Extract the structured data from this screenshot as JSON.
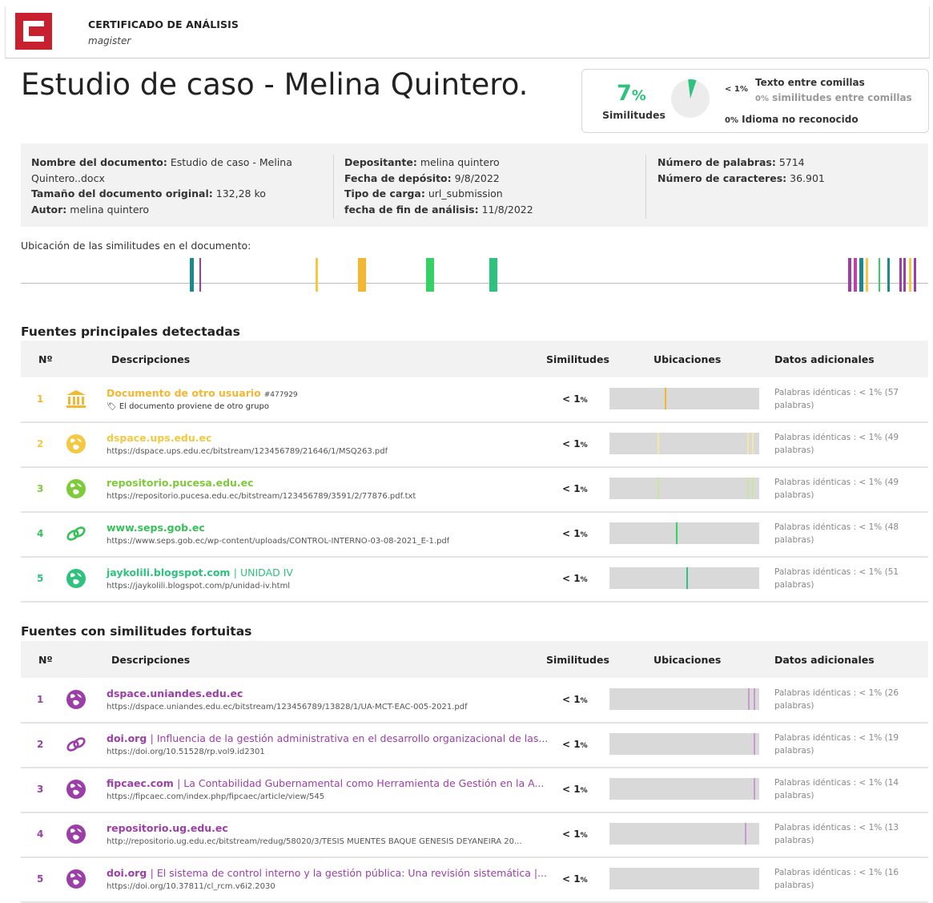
{
  "header": {
    "title": "CERTIFICADO DE ANÁLISIS",
    "subtitle": "magister",
    "logo_text": "C.net"
  },
  "document_title": "Estudio de caso - Melina Quintero.",
  "similarity": {
    "percent": "7",
    "percent_symbol": "%",
    "label": "Similitudes",
    "pie_fraction": 0.07,
    "quotes_value": "< 1%",
    "quotes_title": "Texto entre comillas",
    "quotes_pct": "0%",
    "quotes_sub": "similitudes entre comillas",
    "lang_pct": "0%",
    "lang_label": "Idioma no reconocido",
    "accent_color": "#2ec27e"
  },
  "meta": {
    "col1": {
      "nombre_lbl": "Nombre del documento:",
      "nombre_val": "Estudio de caso - Melina",
      "nombre_val2": "Quintero..docx",
      "tamano_lbl": "Tamaño del documento original:",
      "tamano_val": "132,28 ko",
      "autor_lbl": "Autor:",
      "autor_val": "melina quintero"
    },
    "col2": {
      "dep_lbl": "Depositante:",
      "dep_val": "melina quintero",
      "fecha_lbl": "Fecha de depósito:",
      "fecha_val": "9/8/2022",
      "tipo_lbl": "Tipo de carga:",
      "tipo_val": "url_submission",
      "fin_lbl": "fecha de fin de análisis:",
      "fin_val": "11/8/2022"
    },
    "col3": {
      "pal_lbl": "Número de palabras:",
      "pal_val": "5714",
      "car_lbl": "Número de caracteres:",
      "car_val": "36.901"
    }
  },
  "location_label": "Ubicación de las similitudes en el documento:",
  "location_marks": [
    {
      "pos": 0.186,
      "w": 5,
      "color": "#1a8a8c"
    },
    {
      "pos": 0.197,
      "w": 2,
      "color": "#9c3ea8"
    },
    {
      "pos": 0.325,
      "w": 3,
      "color": "#f5c842"
    },
    {
      "pos": 0.372,
      "w": 10,
      "color": "#f5b731"
    },
    {
      "pos": 0.447,
      "w": 10,
      "color": "#36d164"
    },
    {
      "pos": 0.516,
      "w": 10,
      "color": "#2ec27e"
    },
    {
      "pos": 0.912,
      "w": 4,
      "color": "#9c3ea8"
    },
    {
      "pos": 0.918,
      "w": 4,
      "color": "#c23ea8"
    },
    {
      "pos": 0.924,
      "w": 5,
      "color": "#1a8a8c"
    },
    {
      "pos": 0.931,
      "w": 3,
      "color": "#f5c842"
    },
    {
      "pos": 0.945,
      "w": 2,
      "color": "#36d164"
    },
    {
      "pos": 0.955,
      "w": 3,
      "color": "#1a8a8c"
    },
    {
      "pos": 0.968,
      "w": 3,
      "color": "#9c3ea8"
    },
    {
      "pos": 0.973,
      "w": 3,
      "color": "#9c3ea8"
    },
    {
      "pos": 0.979,
      "w": 3,
      "color": "#f5c842"
    },
    {
      "pos": 0.984,
      "w": 3,
      "color": "#9c3ea8"
    }
  ],
  "table_headers": {
    "num": "Nº",
    "desc": "Descripciones",
    "sim": "Similitudes",
    "loc": "Ubicaciones",
    "extra": "Datos adicionales"
  },
  "principal": {
    "title": "Fuentes principales detectadas",
    "rows": [
      {
        "num": "1",
        "icon": "institution-icon",
        "color": "#f5b731",
        "name": "Documento de otro usuario",
        "id": "#477929",
        "url": "El documento proviene de otro grupo",
        "sim": "< 1",
        "sim_unit": "%",
        "data": "Palabras idénticas : < 1% (57 palabras)",
        "marks": [
          {
            "p": 0.37,
            "c": "#f5b731"
          }
        ]
      },
      {
        "num": "2",
        "icon": "globe-icon",
        "color": "#f5c842",
        "name": "dspace.ups.edu.ec",
        "url": "https://dspace.ups.edu.ec/bitstream/123456789/21646/1/MSQ263.pdf",
        "sim": "< 1",
        "sim_unit": "%",
        "data": "Palabras idénticas : < 1% (49 palabras)",
        "marks": [
          {
            "p": 0.32,
            "c": "#f5e7a8"
          },
          {
            "p": 0.92,
            "c": "#f5e7a8"
          },
          {
            "p": 0.95,
            "c": "#f5e7a8"
          }
        ]
      },
      {
        "num": "3",
        "icon": "globe-icon",
        "color": "#7ecb3a",
        "name": "repositorio.pucesa.edu.ec",
        "url": "https://repositorio.pucesa.edu.ec/bitstream/123456789/3591/2/77876.pdf.txt",
        "sim": "< 1",
        "sim_unit": "%",
        "data": "Palabras idénticas : < 1% (49 palabras)",
        "marks": [
          {
            "p": 0.32,
            "c": "#c9e6a0"
          },
          {
            "p": 0.92,
            "c": "#c9e6a0"
          },
          {
            "p": 0.95,
            "c": "#c9e6a0"
          }
        ]
      },
      {
        "num": "4",
        "icon": "link-icon",
        "color": "#36c15a",
        "name": "www.seps.gob.ec",
        "url": "https://www.seps.gob.ec/wp-content/uploads/CONTROL-INTERNO-03-08-2021_E-1.pdf",
        "sim": "< 1",
        "sim_unit": "%",
        "data": "Palabras idénticas : < 1% (48 palabras)",
        "marks": [
          {
            "p": 0.445,
            "c": "#36d164"
          }
        ]
      },
      {
        "num": "5",
        "icon": "globe-icon",
        "color": "#2ec27e",
        "name": "jaykolili.blogspot.com",
        "sub": "| UNIDAD IV",
        "url": "https://jaykolili.blogspot.com/p/unidad-iv.html",
        "sim": "< 1",
        "sim_unit": "%",
        "data": "Palabras idénticas : < 1% (51 palabras)",
        "marks": [
          {
            "p": 0.515,
            "c": "#2ec27e"
          }
        ]
      }
    ]
  },
  "fortuitas": {
    "title": "Fuentes con similitudes fortuitas",
    "rows": [
      {
        "num": "1",
        "icon": "globe-icon",
        "color": "#9c3ea8",
        "name": "dspace.uniandes.edu.ec",
        "url": "https://dspace.uniandes.edu.ec/bitstream/123456789/13828/1/UA-MCT-EAC-005-2021.pdf",
        "sim": "< 1",
        "sim_unit": "%",
        "data": "Palabras idénticas : < 1% (26 palabras)",
        "marks": [
          {
            "p": 0.925,
            "c": "#c89ad0"
          },
          {
            "p": 0.96,
            "c": "#c89ad0"
          }
        ]
      },
      {
        "num": "2",
        "icon": "link-icon",
        "color": "#9c3ea8",
        "name": "doi.org",
        "sub": "| Influencia de la gestión administrativa en el desarrollo organizacional de las...",
        "url": "https://doi.org/10.51528/rp.vol9.id2301",
        "sim": "< 1",
        "sim_unit": "%",
        "data": "Palabras idénticas : < 1% (19 palabras)",
        "marks": [
          {
            "p": 0.96,
            "c": "#c89ad0"
          }
        ]
      },
      {
        "num": "3",
        "icon": "globe-icon",
        "color": "#9c3ea8",
        "name": "fipcaec.com",
        "sub": "| La Contabilidad Gubernamental como Herramienta de Gestión en la A...",
        "url": "https://fipcaec.com/index.php/fipcaec/article/view/545",
        "sim": "< 1",
        "sim_unit": "%",
        "data": "Palabras idénticas : < 1% (14 palabras)",
        "marks": [
          {
            "p": 0.965,
            "c": "#c89ad0"
          }
        ]
      },
      {
        "num": "4",
        "icon": "globe-icon",
        "color": "#9c3ea8",
        "name": "repositorio.ug.edu.ec",
        "url": "http://repositorio.ug.edu.ec/bitstream/redug/58020/3/TESIS MUENTES BAQUE GÉNESIS DEYANEIRA 20...",
        "sim": "< 1",
        "sim_unit": "%",
        "data": "Palabras idénticas : < 1% (13 palabras)",
        "marks": [
          {
            "p": 0.905,
            "c": "#c89ad0"
          }
        ]
      },
      {
        "num": "5",
        "icon": "globe-icon",
        "color": "#9c3ea8",
        "name": "doi.org",
        "sub": "| El sistema de control interno y la gestión pública: Una revisión sistemática |...",
        "url": "https://doi.org/10.37811/cl_rcm.v6i2.2030",
        "sim": "< 1",
        "sim_unit": "%",
        "data": "Palabras idénticas : < 1% (16 palabras)",
        "marks": []
      }
    ]
  }
}
